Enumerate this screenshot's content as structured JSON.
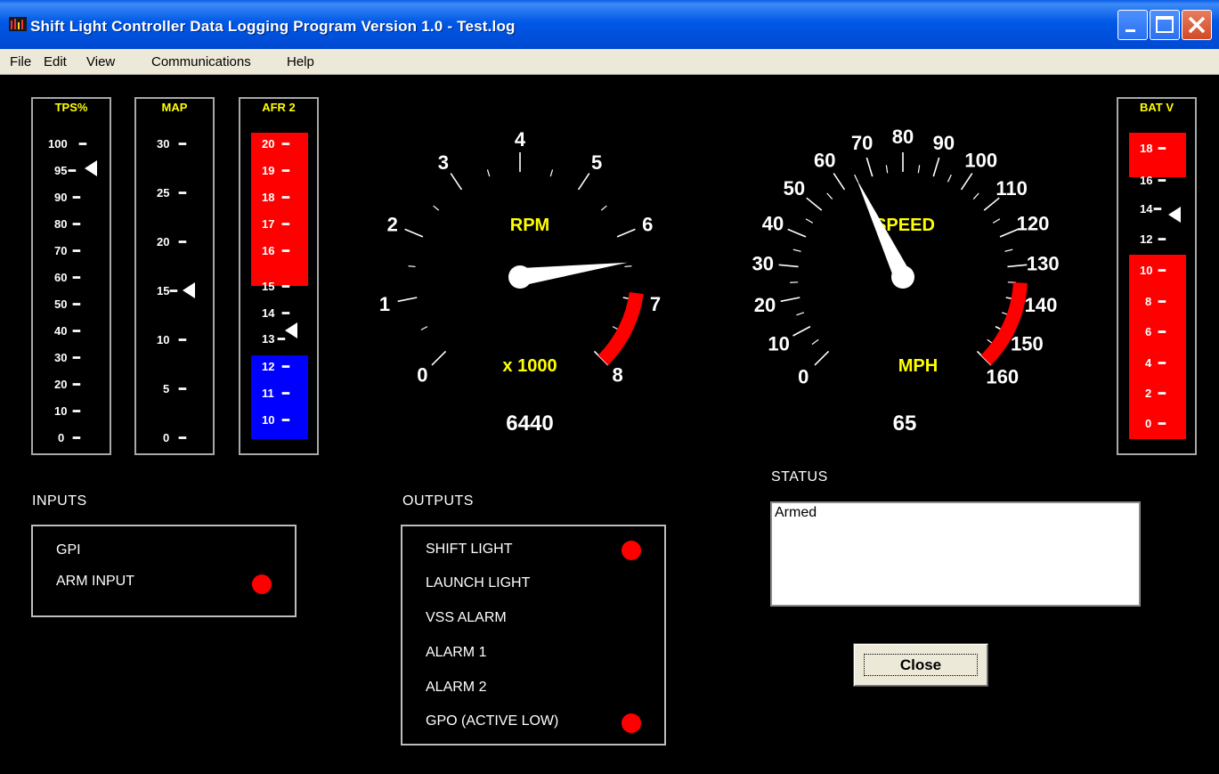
{
  "window": {
    "title": "Shift Light Controller Data Logging Program Version 1.0 - Test.log",
    "menu": [
      "File",
      "Edit",
      "View",
      "Communications",
      "Help"
    ]
  },
  "bar_gauges": {
    "tps": {
      "title": "TPS%",
      "ticks": [
        "100",
        "95",
        "90",
        "80",
        "70",
        "60",
        "50",
        "40",
        "30",
        "20",
        "10",
        "0"
      ],
      "pointer": "95"
    },
    "map": {
      "title": "MAP",
      "ticks": [
        "30",
        "25",
        "20",
        "15",
        "10",
        "5",
        "0"
      ],
      "pointer": "15"
    },
    "afr": {
      "title": "AFR 2",
      "ticks": [
        "20",
        "19",
        "18",
        "17",
        "16",
        "15",
        "14",
        "13",
        "12",
        "11",
        "10"
      ],
      "pointer": "13"
    },
    "batv": {
      "title": "BAT V",
      "ticks": [
        "18",
        "16",
        "14",
        "12",
        "10",
        "8",
        "6",
        "4",
        "2",
        "0"
      ],
      "pointer": "14"
    }
  },
  "rpm_gauge": {
    "title": "RPM",
    "unit": "x 1000",
    "value": "6440",
    "scale": [
      "0",
      "1",
      "2",
      "3",
      "4",
      "5",
      "6",
      "7",
      "8"
    ],
    "needle_value": 6.44
  },
  "speed_gauge": {
    "title": "SPEED",
    "unit": "MPH",
    "value": "65",
    "scale": [
      "0",
      "10",
      "20",
      "30",
      "40",
      "50",
      "60",
      "70",
      "80",
      "90",
      "100",
      "110",
      "120",
      "130",
      "140",
      "150",
      "160"
    ],
    "needle_value": 65
  },
  "inputs": {
    "heading": "INPUTS",
    "items": [
      {
        "label": "GPI",
        "on": false
      },
      {
        "label": "ARM INPUT",
        "on": true
      }
    ]
  },
  "outputs": {
    "heading": "OUTPUTS",
    "items": [
      {
        "label": "SHIFT LIGHT",
        "on": true
      },
      {
        "label": "LAUNCH LIGHT",
        "on": false
      },
      {
        "label": "VSS ALARM",
        "on": false
      },
      {
        "label": "ALARM 1",
        "on": false
      },
      {
        "label": "ALARM 2",
        "on": false
      },
      {
        "label": "GPO (ACTIVE LOW)",
        "on": true
      }
    ]
  },
  "status": {
    "heading": "STATUS",
    "text": "Armed"
  },
  "close_label": "Close",
  "colors": {
    "red": "#ff0000",
    "blue": "#0000ff",
    "yellow": "#ffff00",
    "led_on": "#ff0000"
  }
}
